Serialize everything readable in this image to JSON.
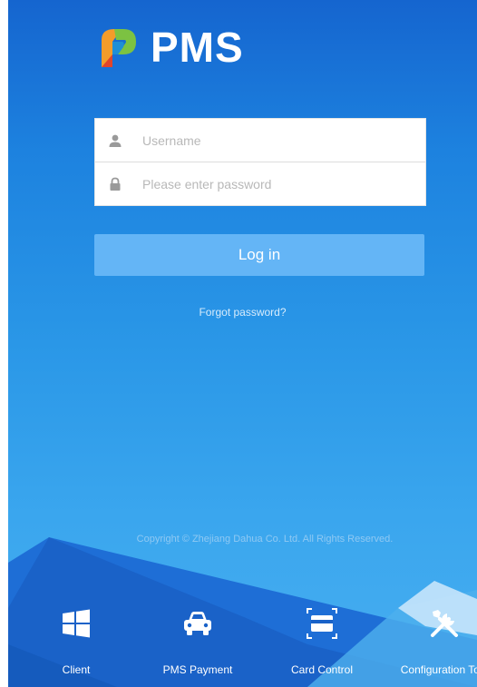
{
  "app": {
    "logo_text": "PMS"
  },
  "login": {
    "username_placeholder": "Username",
    "password_placeholder": "Please enter password",
    "login_label": "Log in",
    "forgot_label": "Forgot password?"
  },
  "footer": {
    "copyright": "Copyright © Zhejiang Dahua Co. Ltd. All Rights Reserved."
  },
  "dock": [
    {
      "label": "Client",
      "icon": "windows-icon"
    },
    {
      "label": "PMS Payment",
      "icon": "car-icon"
    },
    {
      "label": "Card Control",
      "icon": "card-icon"
    },
    {
      "label": "Configuration Tool",
      "icon": "tools-icon"
    }
  ],
  "colors": {
    "accent": "#64b5f6",
    "background_top": "#1565cf",
    "background_bottom": "#47aef0"
  }
}
